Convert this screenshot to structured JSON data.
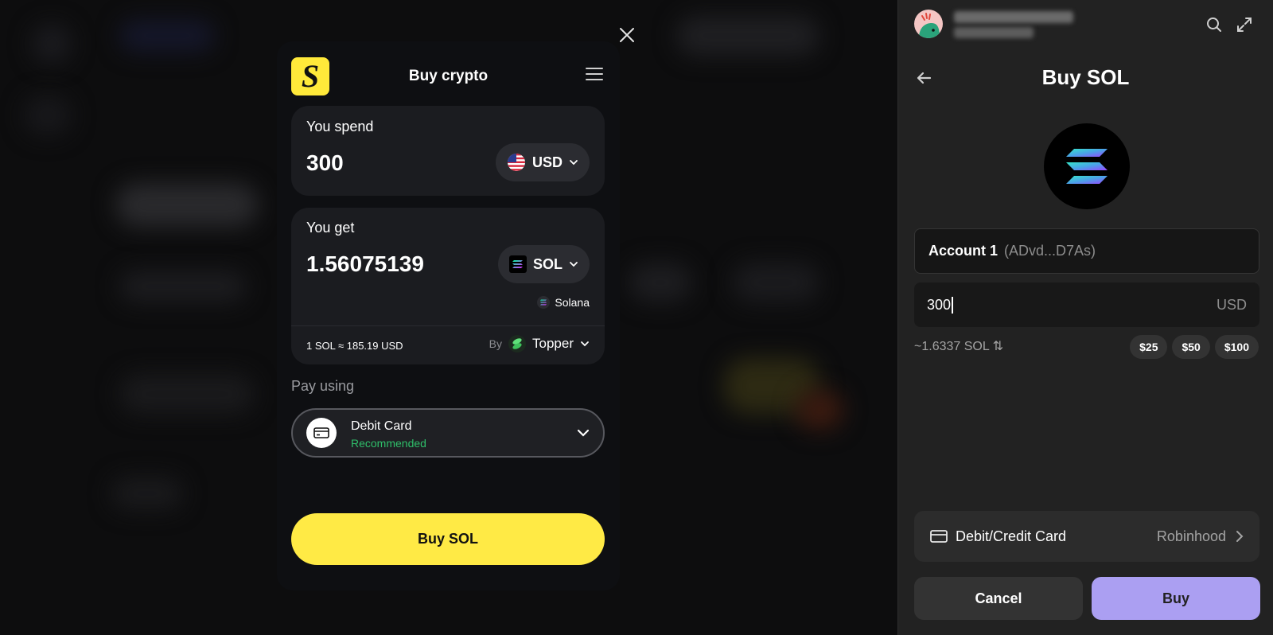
{
  "modal": {
    "logo_letter": "S",
    "title": "Buy crypto",
    "spend": {
      "label": "You spend",
      "amount": "300",
      "currency": "USD"
    },
    "get": {
      "label": "You get",
      "amount": "1.56075139",
      "currency": "SOL",
      "network": "Solana"
    },
    "rate": "1 SOL ≈ 185.19 USD",
    "provider": {
      "by_label": "By",
      "name": "Topper"
    },
    "pay": {
      "label": "Pay using",
      "method": "Debit Card",
      "tag": "Recommended"
    },
    "buy_label": "Buy SOL"
  },
  "panel": {
    "title": "Buy SOL",
    "account": {
      "name": "Account 1",
      "address": "(ADvd...D7As)"
    },
    "amount": {
      "value": "300",
      "currency": "USD"
    },
    "conversion": "~1.6337 SOL ⇅",
    "quick_amounts": [
      "$25",
      "$50",
      "$100"
    ],
    "method": {
      "name": "Debit/Credit Card",
      "provider": "Robinhood"
    },
    "cancel_label": "Cancel",
    "buy_label": "Buy"
  },
  "colors": {
    "brand_yellow": "#ffea45",
    "phantom_purple": "#ab9ff2",
    "recommended_green": "#2fbf6a"
  }
}
